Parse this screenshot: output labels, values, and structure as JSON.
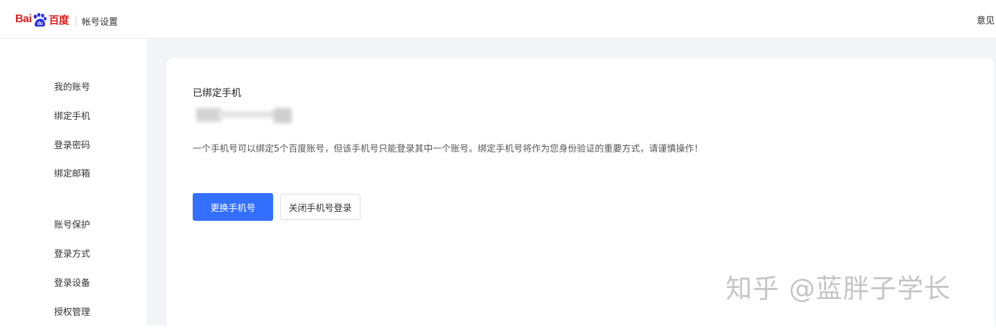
{
  "header": {
    "logo_text_latin": "Bai",
    "logo_text_cn": "百度",
    "title": "帐号设置",
    "right_text": "意见",
    "brand_color": "#de1d1d",
    "logo_paw_color": "#2932e1"
  },
  "sidebar": {
    "groups": [
      {
        "items": [
          {
            "label": "我的账号"
          },
          {
            "label": "绑定手机"
          },
          {
            "label": "登录密码"
          },
          {
            "label": "绑定邮箱"
          }
        ]
      },
      {
        "items": [
          {
            "label": "账号保护"
          },
          {
            "label": "登录方式"
          },
          {
            "label": "登录设备"
          },
          {
            "label": "授权管理"
          }
        ]
      }
    ]
  },
  "main": {
    "section_title": "已绑定手机",
    "phone_value_masked": "",
    "description": "一个手机号可以绑定5个百度账号，但该手机号只能登录其中一个账号。绑定手机号将作为您身份验证的重要方式，请谨慎操作！",
    "primary_button": "更换手机号",
    "secondary_button": "关闭手机号登录",
    "primary_color": "#3370ff"
  },
  "watermark": {
    "text": "知乎 @蓝胖子学长"
  }
}
